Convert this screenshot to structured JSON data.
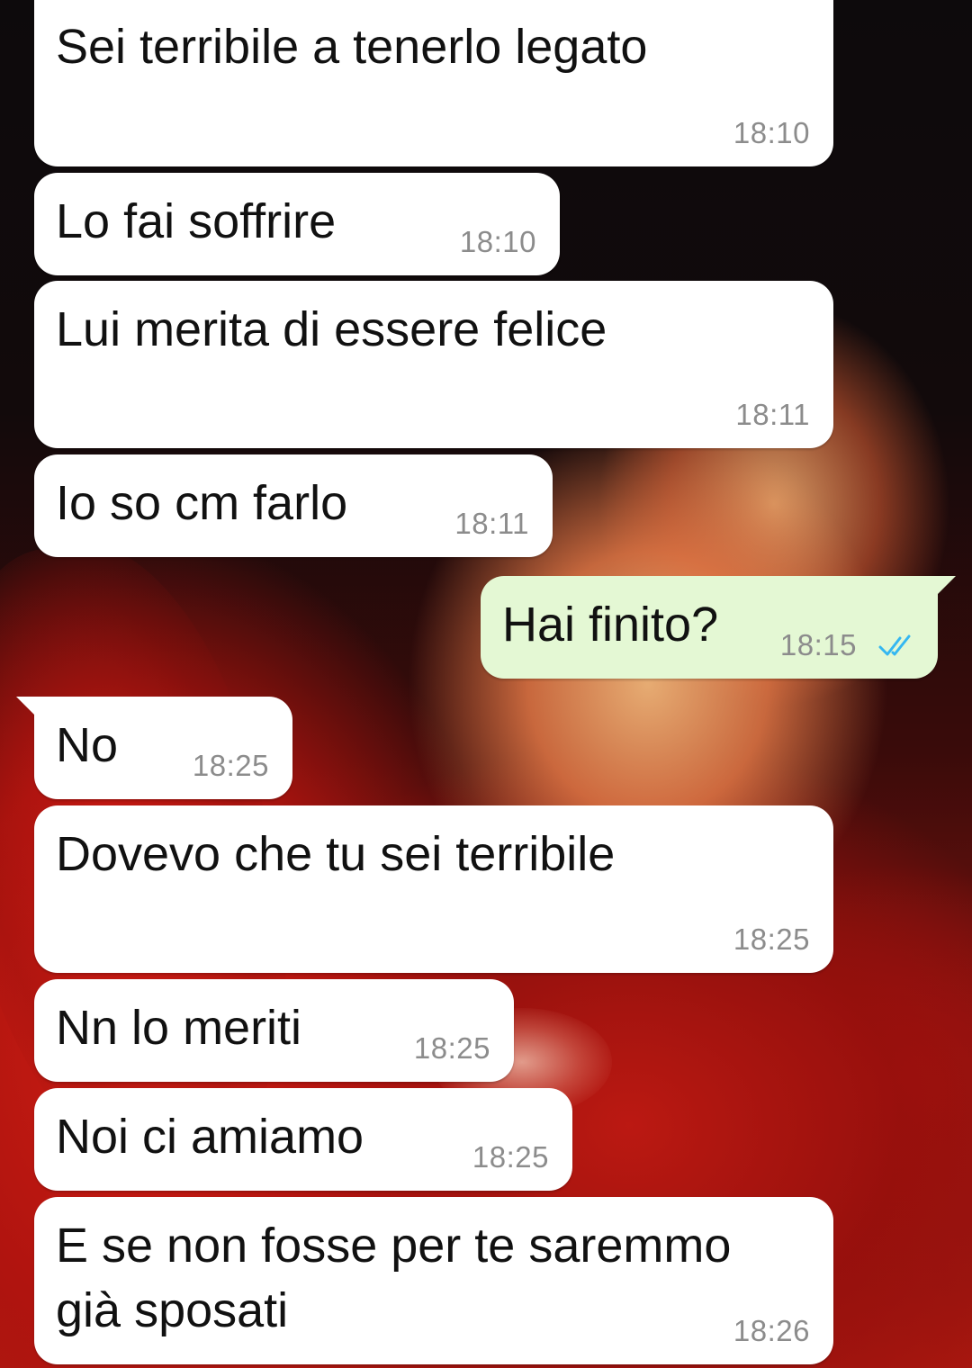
{
  "chat": {
    "messages": [
      {
        "text": "Sei terribile a tenerlo legato",
        "time": "18:10",
        "direction": "incoming"
      },
      {
        "text": "Lo fai soffrire",
        "time": "18:10",
        "direction": "incoming"
      },
      {
        "text": "Lui merita di essere felice",
        "time": "18:11",
        "direction": "incoming"
      },
      {
        "text": "Io so cm farlo",
        "time": "18:11",
        "direction": "incoming"
      },
      {
        "text": "Hai finito?",
        "time": "18:15",
        "direction": "outgoing",
        "status": "read",
        "status_icon": "double-check-icon",
        "status_color": "#34b7f1"
      },
      {
        "text": "No",
        "time": "18:25",
        "direction": "incoming"
      },
      {
        "text": "Dovevo che tu sei terribile",
        "time": "18:25",
        "direction": "incoming"
      },
      {
        "text": "Nn lo meriti",
        "time": "18:25",
        "direction": "incoming"
      },
      {
        "text": "Noi ci amiamo",
        "time": "18:25",
        "direction": "incoming"
      },
      {
        "text": "E se non fosse per te saremmo\ngià sposati",
        "time": "18:26",
        "direction": "incoming"
      }
    ]
  },
  "colors": {
    "incoming_bubble": "#ffffff",
    "outgoing_bubble": "#e4f8d4",
    "timestamp": "#8c8c8c",
    "read_ticks": "#34b7f1"
  }
}
